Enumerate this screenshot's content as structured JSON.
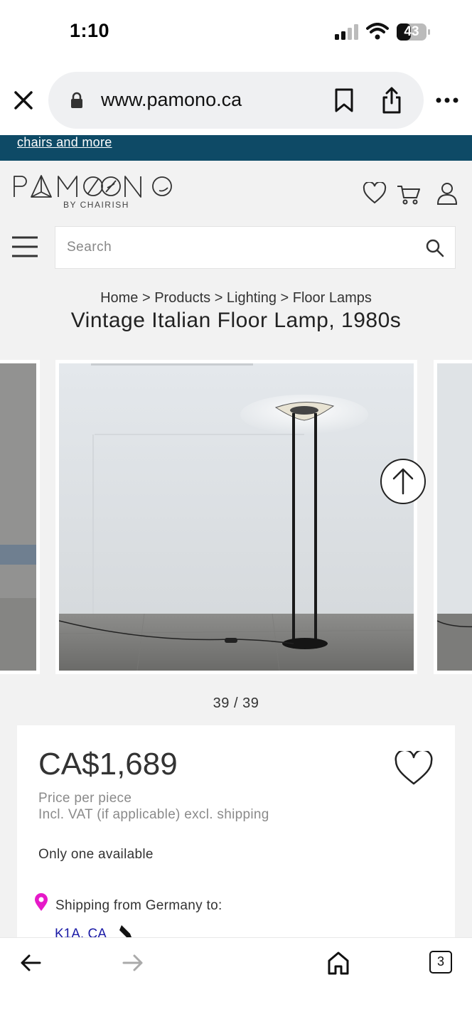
{
  "status_bar": {
    "time": "1:10",
    "battery": "43"
  },
  "browser": {
    "url": "www.pamono.ca",
    "tab_count": "3"
  },
  "promo": {
    "link_text": "chairs and more"
  },
  "site": {
    "logo_text": "PAMONO",
    "logo_sub": "BY CHAIRISH",
    "search_placeholder": "Search",
    "breadcrumb": "Home > Products > Lighting > Floor Lamps",
    "title": "Vintage Italian Floor Lamp, 1980s"
  },
  "gallery": {
    "counter": "39 / 39"
  },
  "product": {
    "price": "CA$1,689",
    "price_note": "Price per piece",
    "vat_note": "Incl. VAT (if applicable) excl. shipping",
    "availability": "Only one available",
    "shipping": "Shipping from Germany to:",
    "destination": "K1A, CA"
  },
  "colors": {
    "promo_bg": "#0e4a66",
    "page_bg": "#f2f2f2",
    "pin": "#e619c8",
    "link": "#1a1aa6"
  }
}
